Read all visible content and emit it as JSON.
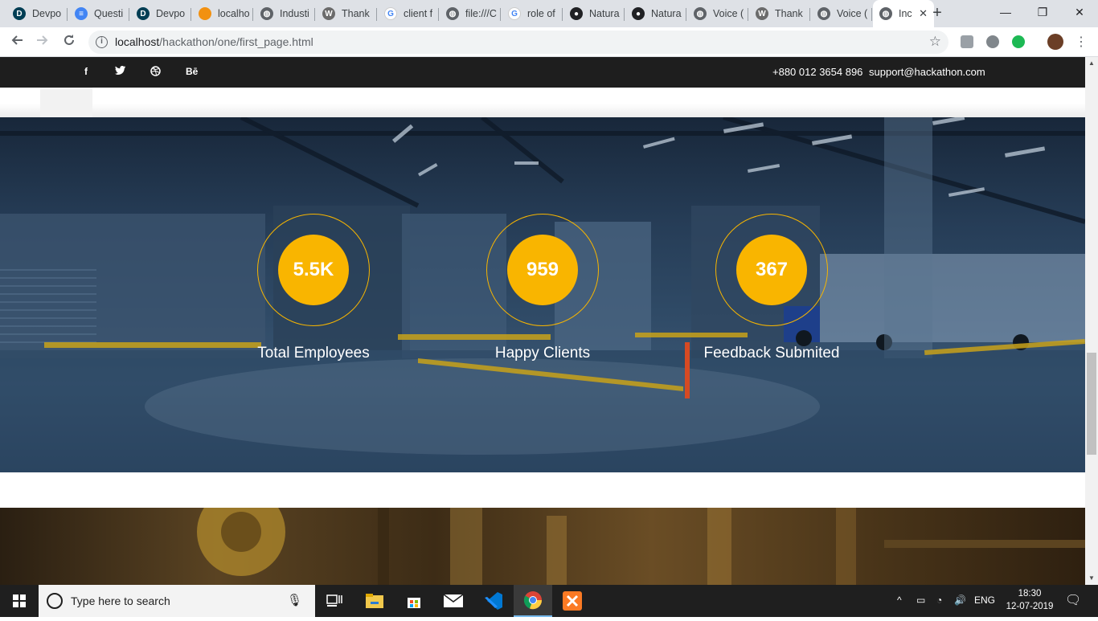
{
  "browser": {
    "tabs": [
      {
        "title": "Devpo",
        "icon": "devpost-icon",
        "color": "#003e54",
        "letter": "D"
      },
      {
        "title": "Questi",
        "icon": "google-docs-icon",
        "color": "#4285f4",
        "letter": "≡"
      },
      {
        "title": "Devpo",
        "icon": "devpost-icon",
        "color": "#003e54",
        "letter": "D"
      },
      {
        "title": "localho",
        "icon": "phpmyadmin-icon",
        "color": "#f29111",
        "letter": "pma"
      },
      {
        "title": "Industi",
        "icon": "globe-icon",
        "color": "#5f6368",
        "letter": "◍"
      },
      {
        "title": "Thank",
        "icon": "wordpress-icon",
        "color": "#6b6b6b",
        "letter": "W"
      },
      {
        "title": "client f",
        "icon": "google-icon",
        "color": "#ffffff",
        "letter": "G"
      },
      {
        "title": "file:///C",
        "icon": "globe-icon",
        "color": "#5f6368",
        "letter": "◍"
      },
      {
        "title": "role of",
        "icon": "google-icon",
        "color": "#ffffff",
        "letter": "G"
      },
      {
        "title": "Natura",
        "icon": "github-icon",
        "color": "#202124",
        "letter": "●"
      },
      {
        "title": "Natura",
        "icon": "github-icon",
        "color": "#202124",
        "letter": "●"
      },
      {
        "title": "Voice (",
        "icon": "globe-icon",
        "color": "#5f6368",
        "letter": "◍"
      },
      {
        "title": "Thank",
        "icon": "wordpress-icon",
        "color": "#6b6b6b",
        "letter": "W"
      },
      {
        "title": "Voice (",
        "icon": "globe-icon",
        "color": "#5f6368",
        "letter": "◍"
      },
      {
        "title": "Inc",
        "icon": "globe-icon",
        "color": "#5f6368",
        "letter": "◍",
        "active": true
      }
    ],
    "url_host": "localhost",
    "url_path": "/hackathon/one/first_page.html",
    "new_tab_symbol": "+",
    "close_symbol": "✕"
  },
  "page": {
    "social": [
      "f",
      "t",
      "dribbble",
      "Bē"
    ],
    "phone": "+880 012 3654 896",
    "email": "support@hackathon.com",
    "counters": [
      {
        "value": "5.5K",
        "label": "Total Employees"
      },
      {
        "value": "959",
        "label": "Happy Clients"
      },
      {
        "value": "367",
        "label": "Feedback Submited"
      }
    ],
    "accent": "#f9b500"
  },
  "taskbar": {
    "search_placeholder": "Type here to search",
    "language": "ENG",
    "time": "18:30",
    "date": "12-07-2019",
    "apps": [
      "task-view-icon",
      "file-explorer-icon",
      "store-icon",
      "mail-icon",
      "vscode-icon",
      "chrome-icon",
      "xampp-icon"
    ]
  }
}
